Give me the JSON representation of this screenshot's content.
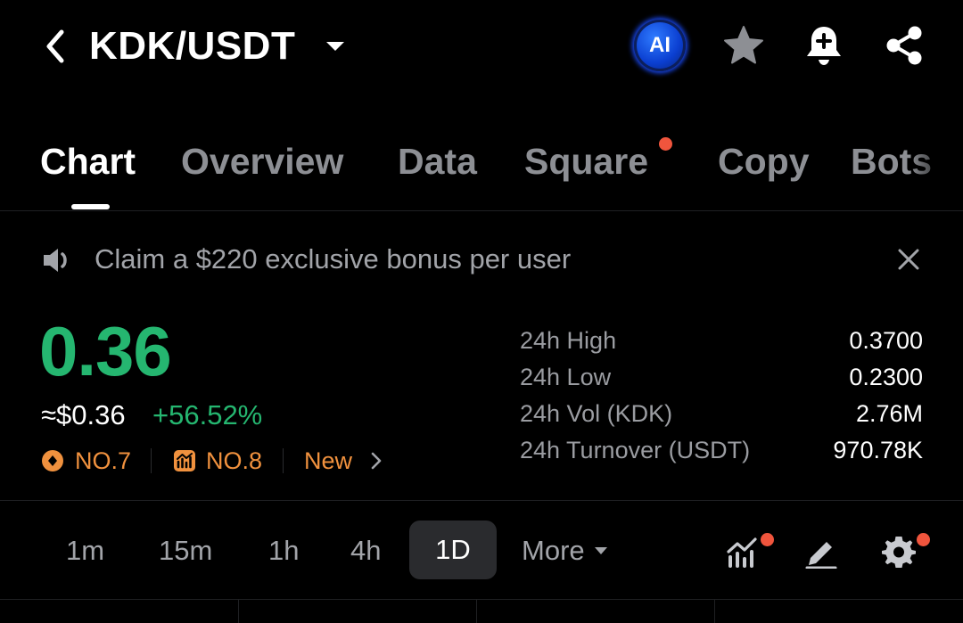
{
  "header": {
    "pair": "KDK/USDT",
    "ai_label": "AI",
    "icons": [
      "back-chevron-icon",
      "dropdown-caret-icon",
      "star-icon",
      "bell-plus-icon",
      "share-icon"
    ]
  },
  "tabs": [
    {
      "label": "Chart",
      "active": true
    },
    {
      "label": "Overview",
      "active": false
    },
    {
      "label": "Data",
      "active": false
    },
    {
      "label": "Square",
      "active": false,
      "notification": true
    },
    {
      "label": "Copy",
      "active": false
    },
    {
      "label": "Bots",
      "active": false
    }
  ],
  "banner": {
    "text": "Claim a $220 exclusive bonus per user"
  },
  "price": {
    "last": "0.36",
    "usd": "≈$0.36",
    "change": "+56.52%"
  },
  "ranks": [
    {
      "label": "NO.7",
      "icon": "hot-rank-icon"
    },
    {
      "label": "NO.8",
      "icon": "gainers-rank-icon"
    },
    {
      "label": "New",
      "icon": "chevron-right-icon"
    }
  ],
  "stats": [
    {
      "label": "24h High",
      "value": "0.3700"
    },
    {
      "label": "24h Low",
      "value": "0.2300"
    },
    {
      "label": "24h Vol (KDK)",
      "value": "2.76M"
    },
    {
      "label": "24h Turnover (USDT)",
      "value": "970.78K"
    }
  ],
  "intervals": {
    "items": [
      "1m",
      "15m",
      "1h",
      "4h",
      "1D"
    ],
    "selected": "1D",
    "more": "More"
  },
  "colors": {
    "up": "#25b670",
    "rank": "#f0913e",
    "alert_dot": "#f0553d",
    "muted": "#8d8f94"
  }
}
